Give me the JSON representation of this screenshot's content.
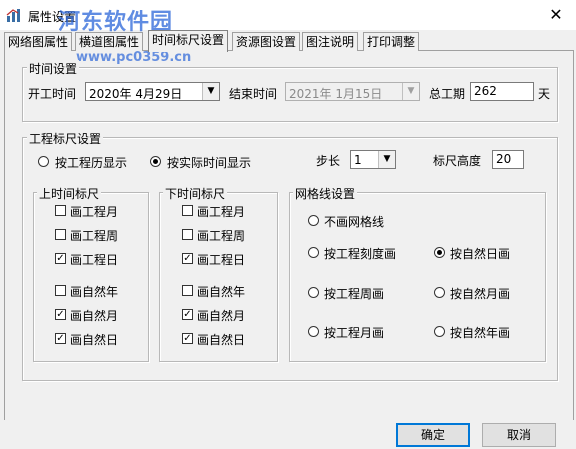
{
  "window": {
    "title": "属性设置",
    "close_glyph": "✕"
  },
  "watermark": {
    "brand": "河东软件园",
    "url": "www.pc0359.cn"
  },
  "tabs": [
    {
      "label": "网络图属性",
      "active": false
    },
    {
      "label": "横道图属性",
      "active": false
    },
    {
      "label": "时间标尺设置",
      "active": true
    },
    {
      "label": "资源图设置",
      "active": false
    },
    {
      "label": "图注说明",
      "active": false
    },
    {
      "label": "打印调整",
      "active": false
    }
  ],
  "time_settings": {
    "group_title": "时间设置",
    "start_label": "开工时间",
    "start_value": "2020年 4月29日",
    "end_label": "结束时间",
    "end_value": "2021年 1月15日",
    "duration_label": "总工期",
    "duration_value": "262",
    "duration_unit": "天"
  },
  "ruler_settings": {
    "group_title": "工程标尺设置",
    "radio_by_calendar": "按工程历显示",
    "radio_by_actual": "按实际时间显示",
    "selected": "按实际时间显示",
    "step_label": "步长",
    "step_value": "1",
    "height_label": "标尺高度",
    "height_value": "20"
  },
  "upper_ruler": {
    "title": "上时间标尺",
    "items": [
      {
        "label": "画工程月",
        "checked": false
      },
      {
        "label": "画工程周",
        "checked": false
      },
      {
        "label": "画工程日",
        "checked": true
      },
      {
        "label": "画自然年",
        "checked": false
      },
      {
        "label": "画自然月",
        "checked": true
      },
      {
        "label": "画自然日",
        "checked": true
      }
    ]
  },
  "lower_ruler": {
    "title": "下时间标尺",
    "items": [
      {
        "label": "画工程月",
        "checked": false
      },
      {
        "label": "画工程周",
        "checked": false
      },
      {
        "label": "画工程日",
        "checked": true
      },
      {
        "label": "画自然年",
        "checked": false
      },
      {
        "label": "画自然月",
        "checked": true
      },
      {
        "label": "画自然日",
        "checked": true
      }
    ]
  },
  "grid_settings": {
    "title": "网格线设置",
    "options": [
      {
        "label": "不画网格线",
        "selected": false
      },
      {
        "label": "按工程刻度画",
        "selected": false
      },
      {
        "label": "按自然日画",
        "selected": true
      },
      {
        "label": "按工程周画",
        "selected": false
      },
      {
        "label": "按自然月画",
        "selected": false
      },
      {
        "label": "按工程月画",
        "selected": false
      },
      {
        "label": "按自然年画",
        "selected": false
      }
    ]
  },
  "buttons": {
    "ok": "确定",
    "cancel": "取消"
  },
  "check_glyph": "✓"
}
